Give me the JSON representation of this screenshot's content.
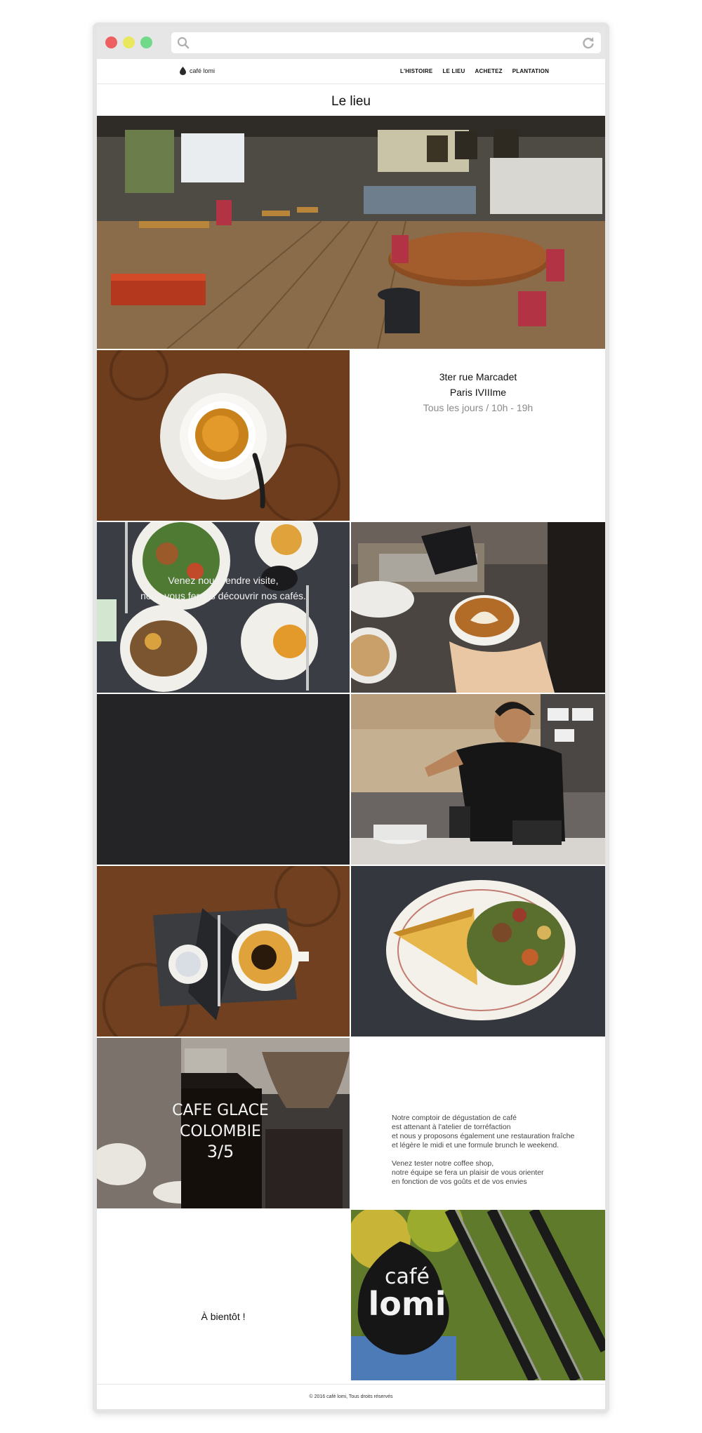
{
  "site": {
    "logo_text": "café lomi"
  },
  "nav": {
    "items": [
      "L'HISTOIRE",
      "LE LIEU",
      "ACHETEZ",
      "PLANTATION"
    ]
  },
  "page": {
    "title": "Le lieu"
  },
  "info": {
    "address_line1": "3ter rue Marcadet",
    "address_line2": "Paris IVIIIme",
    "hours": "Tous les jours  / 10h - 19h"
  },
  "visit": {
    "line1": "Venez nous rendre visite,",
    "line2": "nous vous ferons découvrir nos cafés."
  },
  "description": {
    "p1_l1": "Notre comptoir de dégustation de café",
    "p1_l2": "est attenant à l'atelier de torréfaction",
    "p1_l3": "et nous y proposons également une restauration fraîche",
    "p1_l4": "et légère le midi et une formule brunch le weekend.",
    "p2_l1": "Venez tester notre coffee shop,",
    "p2_l2": "notre équipe se fera un plaisir de vous orienter",
    "p2_l3": "en fonction de vos goûts et de vos envies"
  },
  "farewell": "À bientôt !",
  "photos": {
    "bottle_label_l1": "CAFE GLACE",
    "bottle_label_l2": "COLOMBIE",
    "bottle_label_l3": "3/5",
    "sign_l1": "café",
    "sign_l2": "lomi"
  },
  "footer": {
    "copyright": "© 2016 café lomi, Tous droits réservés"
  },
  "colors": {
    "chrome_bg": "#e6e6e6",
    "dot_red": "#ee5f61",
    "dot_yellow": "#e9e85c",
    "dot_green": "#72d98a",
    "dark_tile": "#242426"
  }
}
